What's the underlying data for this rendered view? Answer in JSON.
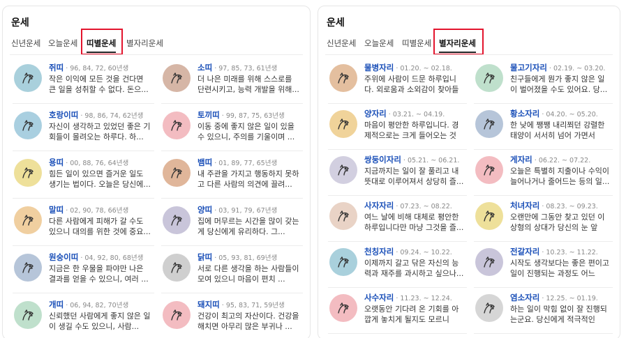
{
  "left": {
    "title": "운세",
    "tabs": [
      {
        "label": "신년운세"
      },
      {
        "label": "오늘운세"
      },
      {
        "label": "띠별운세"
      },
      {
        "label": "별자리운세"
      }
    ],
    "active_tab": "띠별운세",
    "items": [
      {
        "name": "쥐띠",
        "meta": "96, 84, 72, 60년생",
        "desc": "작은 이익에 모든 것을 건다면 큰 일을 성취할 수 없다. 돈으...",
        "icon": "rat-icon",
        "color": "#a9d0dc"
      },
      {
        "name": "소띠",
        "meta": "97, 85, 73, 61년생",
        "desc": "더 나은 미래를 위해 스스로를 단련시키고, 능력 개발을 위해...",
        "icon": "ox-icon",
        "color": "#d6b6a6"
      },
      {
        "name": "호랑이띠",
        "meta": "98, 86, 74, 62년생",
        "desc": "자신이 생각하고 있었던 좋은 기회들이 몰려오는 하루다. 하...",
        "icon": "tiger-icon",
        "color": "#a9cfe0"
      },
      {
        "name": "토끼띠",
        "meta": "99, 87, 75, 63년생",
        "desc": "이동 중에 좋지 않은 일이 있을 수 있으니, 주의를 기울이며 ...",
        "icon": "rabbit-icon",
        "color": "#f3bcc1"
      },
      {
        "name": "용띠",
        "meta": "00, 88, 76, 64년생",
        "desc": "힘든 일이 있으면 즐거운 일도 생기는 법이다. 오늘은 당신에...",
        "icon": "dragon-icon",
        "color": "#eee09a"
      },
      {
        "name": "뱀띠",
        "meta": "01, 89, 77, 65년생",
        "desc": "내 주관을 가지고 행동하지 못하고 다른 사람의 의견에 끌려...",
        "icon": "snake-icon",
        "color": "#e0b69a"
      },
      {
        "name": "말띠",
        "meta": "02, 90, 78, 66년생",
        "desc": "다른 사람에게 피해가 갈 수도 있으니 대의를 위한 것에 중요...",
        "icon": "horse-icon",
        "color": "#f0cfa0"
      },
      {
        "name": "양띠",
        "meta": "03, 91, 79, 67년생",
        "desc": "집에 머무르는 시간을 많이 갖는 게 당신에게 유리하다. 그...",
        "icon": "sheep-icon",
        "color": "#c9c5da"
      },
      {
        "name": "원숭이띠",
        "meta": "04, 92, 80, 68년생",
        "desc": "지금은 한 우물을 파야만 나은 결과를 얻을 수 있으니, 여러 ...",
        "icon": "monkey-icon",
        "color": "#b6c5d9"
      },
      {
        "name": "닭띠",
        "meta": "05, 93, 81, 69년생",
        "desc": "서로 다른 생각을 하는 사람들이 모여 있으니 마음이 편치 ...",
        "icon": "rooster-icon",
        "color": "#cfcfcf"
      },
      {
        "name": "개띠",
        "meta": "06, 94, 82, 70년생",
        "desc": "신뢰했던 사람에게 좋지 않은 일이 생길 수도 있으니, 사람...",
        "icon": "dog-icon",
        "color": "#bfe0cc"
      },
      {
        "name": "돼지띠",
        "meta": "95, 83, 71, 59년생",
        "desc": "건강이 최고의 자산이다. 건강을 해치면 아무리 많은 부귀나 ...",
        "icon": "pig-icon",
        "color": "#f3bcc1"
      }
    ]
  },
  "right": {
    "title": "운세",
    "tabs": [
      {
        "label": "신년운세"
      },
      {
        "label": "오늘운세"
      },
      {
        "label": "띠별운세"
      },
      {
        "label": "별자리운세"
      }
    ],
    "active_tab": "별자리운세",
    "items": [
      {
        "name": "물병자리",
        "meta": "01.20. ~ 02.18.",
        "desc": "주위에 사람이 드문 하루입니다. 외로움과 소외감이 찾아들 것...",
        "icon": "aquarius-icon",
        "color": "#e4bf9f"
      },
      {
        "name": "물고기자리",
        "meta": "02.19. ~ 03.20.",
        "desc": "친구들에게 뭔가 좋지 않은 일이 벌어졌을 수도 있어요. 당...",
        "icon": "pisces-icon",
        "color": "#bfe0cc"
      },
      {
        "name": "양자리",
        "meta": "03.21. ~ 04.19.",
        "desc": "마음이 평안한 하루입니다. 경제적으로는 크게 들어오는 것이...",
        "icon": "aries-icon",
        "color": "#f0d39a"
      },
      {
        "name": "황소자리",
        "meta": "04.20. ~ 05.20.",
        "desc": "한 낮에 쨍쨍 내리쬐던 강렬한 태양이 서서히 넘어 가면서 점...",
        "icon": "taurus-icon",
        "color": "#b6c5d9"
      },
      {
        "name": "쌍둥이자리",
        "meta": "05.21. ~ 06.21.",
        "desc": "지금까지는 일이 잘 풀리고 내 뜻대로 이루어져서 상당히 즐...",
        "icon": "gemini-icon",
        "color": "#d2cfe0"
      },
      {
        "name": "게자리",
        "meta": "06.22. ~ 07.22.",
        "desc": "오늘은 특별히 지출이나 수익이 늘어나거나 줄어드는 등의 일...",
        "icon": "cancer-icon",
        "color": "#f3bcc1"
      },
      {
        "name": "사자자리",
        "meta": "07.23. ~ 08.22.",
        "desc": "여느 날에 비해 대체로 평안한 하루입니다만 마냥 그것을 즐...",
        "icon": "leo-icon",
        "color": "#e9d3c6"
      },
      {
        "name": "처녀자리",
        "meta": "08.23. ~ 09.23.",
        "desc": "오랜만에 그동안 찾고 있던 이상형의 상대가 당신의 눈 앞에...",
        "icon": "virgo-icon",
        "color": "#eee09a"
      },
      {
        "name": "천칭자리",
        "meta": "09.24. ~ 10.22.",
        "desc": "이제까지 갈고 닦은 자신의 능력과 재주를 과시하고 싶으나...",
        "icon": "libra-icon",
        "color": "#a9d0dc"
      },
      {
        "name": "전갈자리",
        "meta": "10.23. ~ 11.22.",
        "desc": "시작도 생각보다는 좋은 편이고 일이 진행되는 과정도 어느 정...",
        "icon": "scorpio-icon",
        "color": "#c9c5da"
      },
      {
        "name": "사수자리",
        "meta": "11.23. ~ 12.24.",
        "desc": "오랫동안 기다려 온 기회를 아깝게 놓치게 될지도 모르니 긴...",
        "icon": "sagittarius-icon",
        "color": "#f3bcc1"
      },
      {
        "name": "염소자리",
        "meta": "12.25. ~ 01.19.",
        "desc": "하는 일이 막힘 없이 잘 진행되는군요. 당신에게 적극적인 활...",
        "icon": "capricorn-icon",
        "color": "#d6d6d6"
      }
    ]
  }
}
